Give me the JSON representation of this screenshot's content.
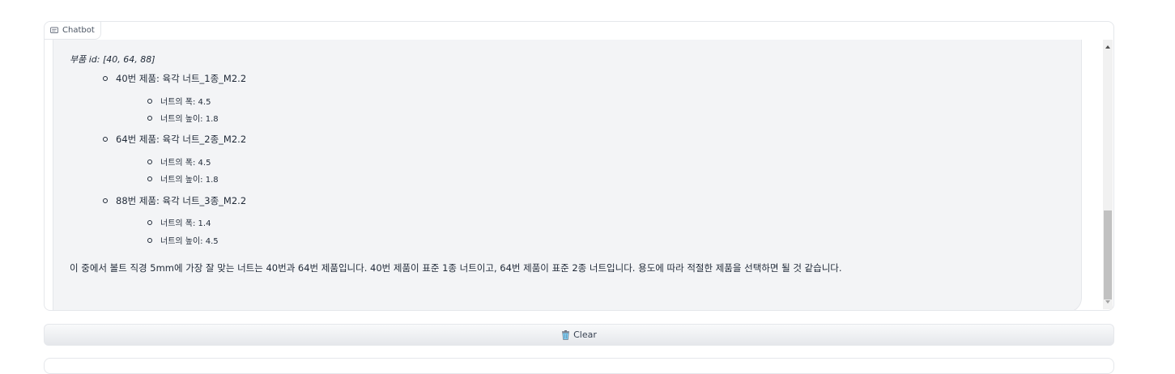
{
  "chatbot": {
    "label": "Chatbot",
    "label_icon": "chat-bubble-icon"
  },
  "message": {
    "part_id_line": "부품 id: [40, 64, 88]",
    "products": [
      {
        "title": "40번 제품: 육각 너트_1종_M2.2",
        "specs": [
          "너트의 폭: 4.5",
          "너트의 높이: 1.8"
        ]
      },
      {
        "title": "64번 제품: 육각 너트_2종_M2.2",
        "specs": [
          "너트의 폭: 4.5",
          "너트의 높이: 1.8"
        ]
      },
      {
        "title": "88번 제품: 육각 너트_3종_M2.2",
        "specs": [
          "너트의 폭: 1.4",
          "너트의 높이: 4.5"
        ]
      }
    ],
    "conclusion": "이 중에서 볼트 직경 5mm에 가장 잘 맞는 너트는 40번과 64번 제품입니다. 40번 제품이 표준 1종 너트이고, 64번 제품이 표준 2종 너트입니다. 용도에 따라 적절한 제품을 선택하면 될 것 같습니다."
  },
  "clear_button": {
    "label": "Clear",
    "icon": "trash-icon"
  },
  "colors": {
    "message_bg": "#f3f4f6",
    "border": "#e5e7eb",
    "scroll_thumb": "#c1c1c1"
  }
}
